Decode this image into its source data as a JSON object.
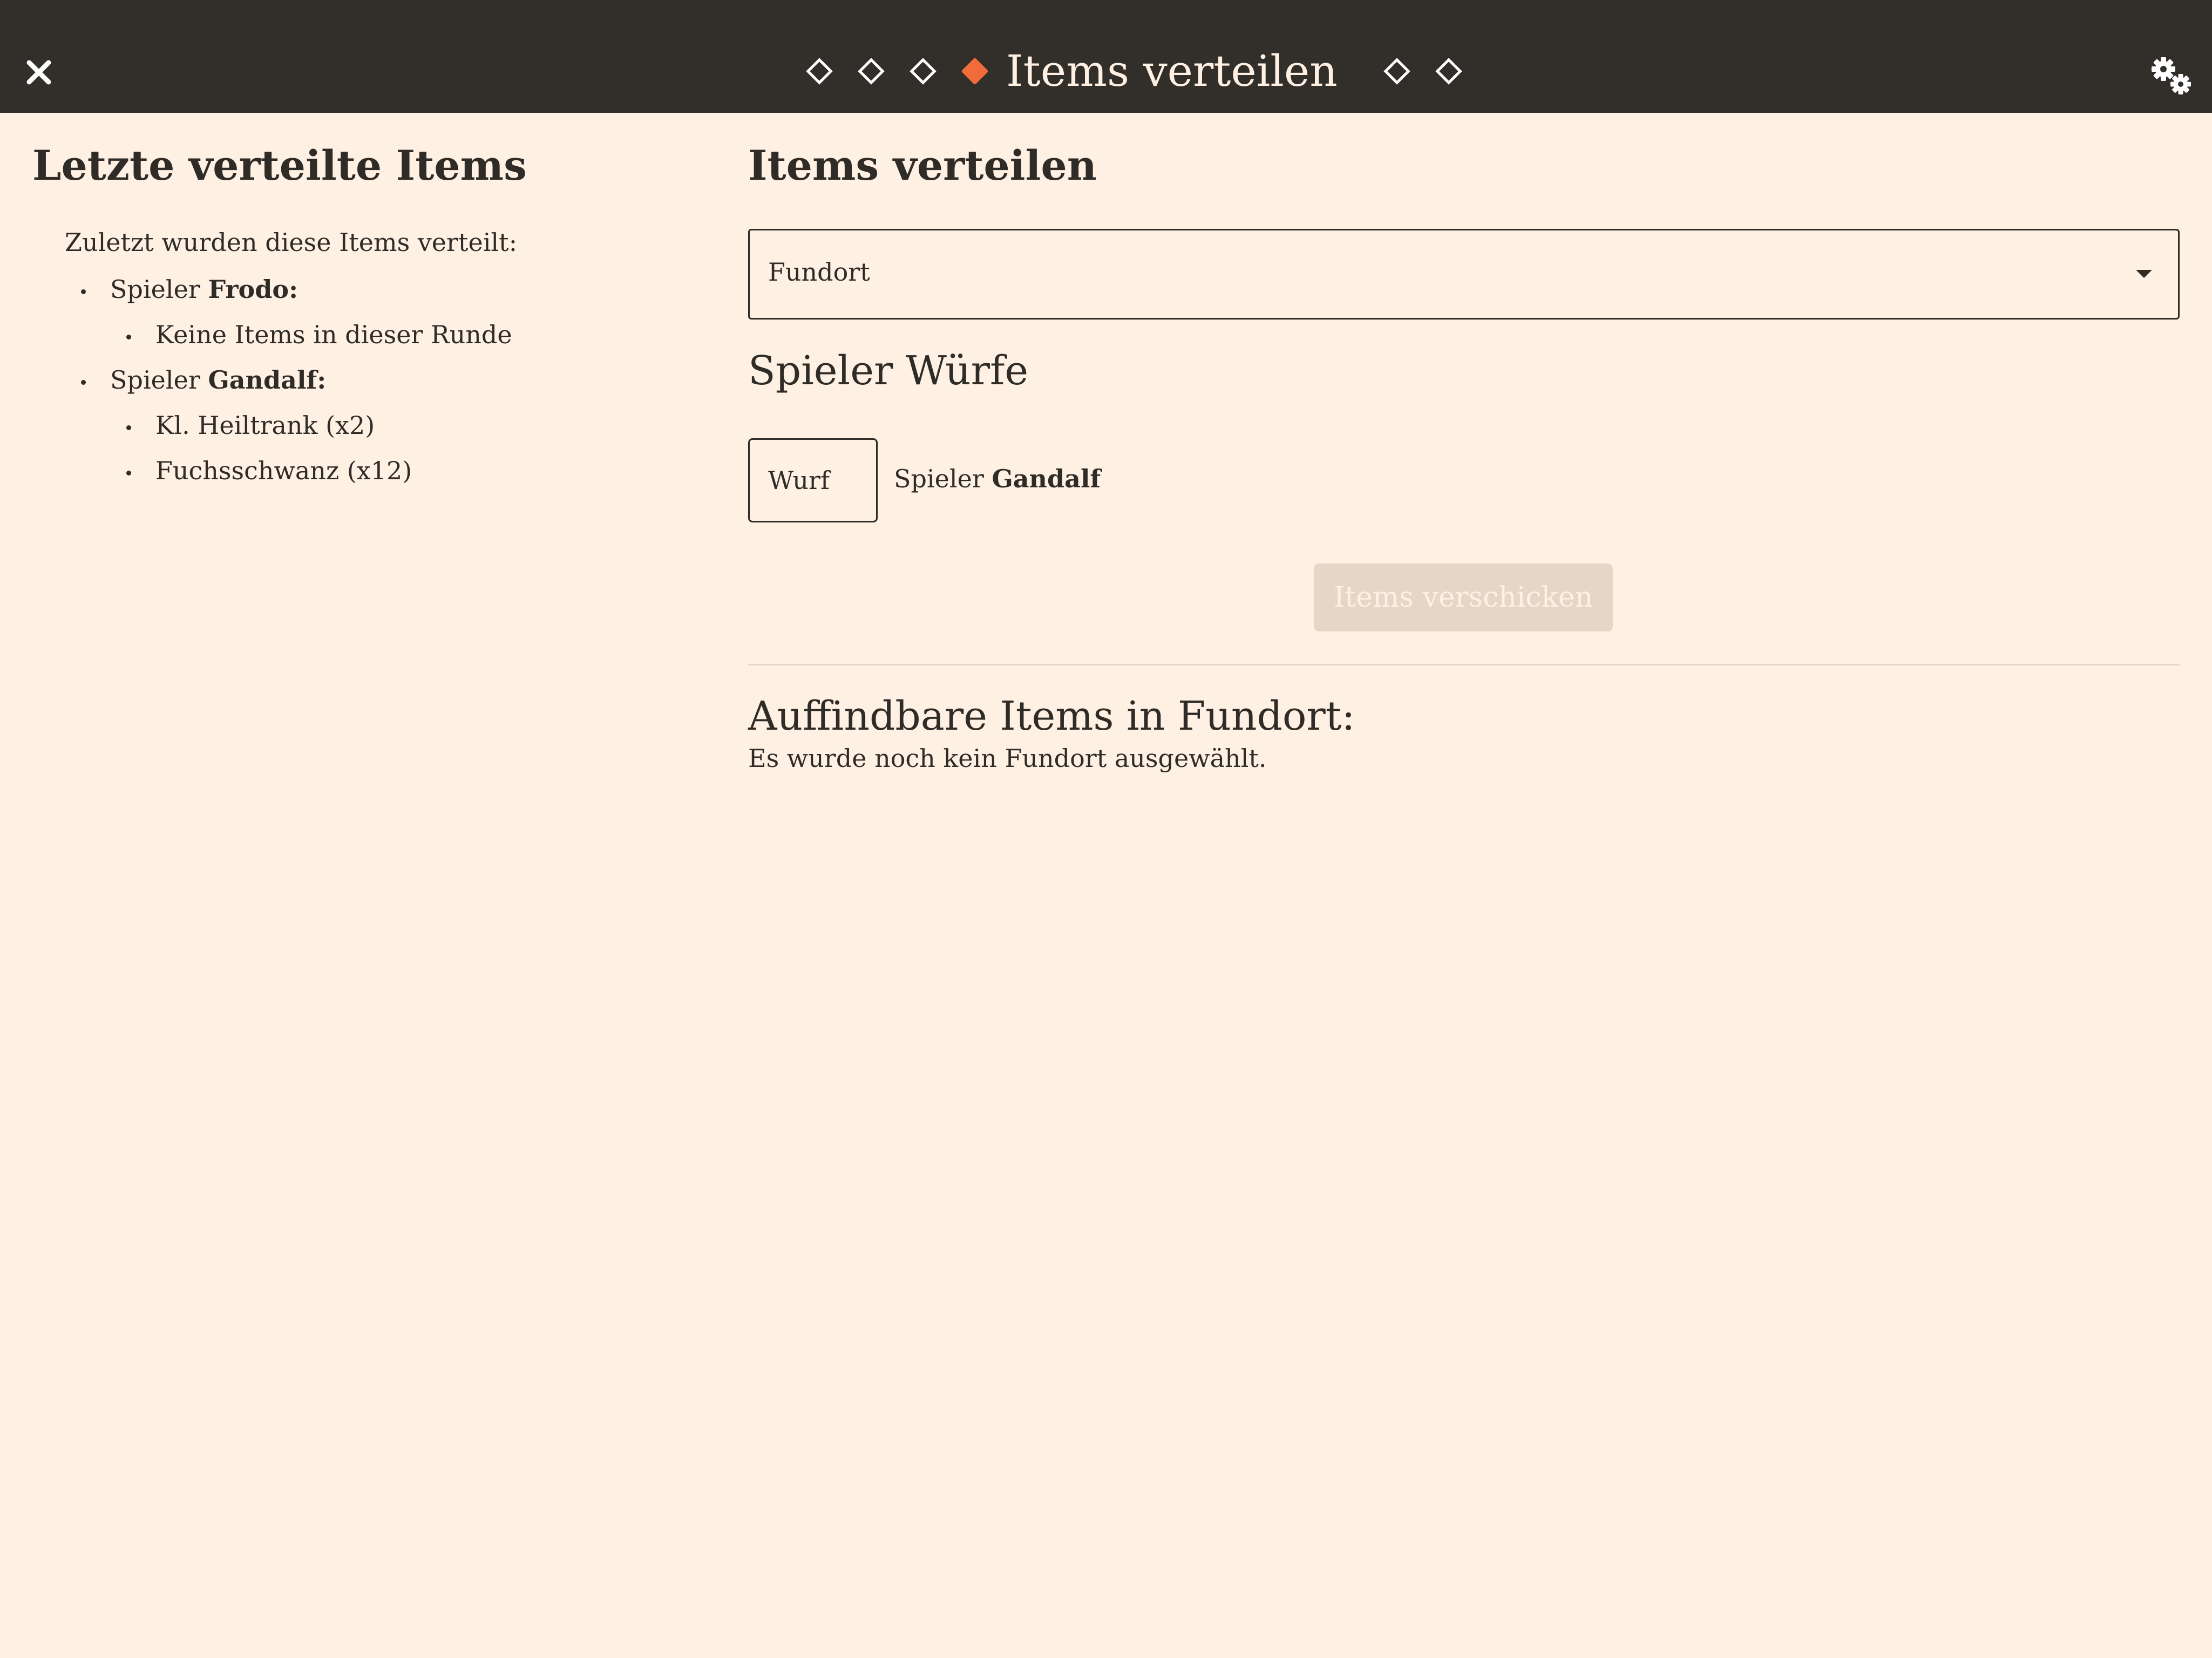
{
  "header": {
    "close_icon": "close-icon",
    "settings_icon": "gears-icon",
    "current_step_title": "Items verteilen",
    "steps_before_current": 3,
    "steps_after_current": 2,
    "active_color": "#f26b3a",
    "bar_color": "#322e2a"
  },
  "recent": {
    "title": "Letzte verteilte Items",
    "intro": "Zuletzt wurden diese Items verteilt:",
    "player_prefix": "Spieler",
    "players": [
      {
        "name": "Frodo:",
        "items": [
          "Keine Items in dieser Runde"
        ]
      },
      {
        "name": "Gandalf:",
        "items": [
          "Kl. Heiltrank (x2)",
          "Fuchsschwanz (x12)"
        ]
      }
    ]
  },
  "distribute": {
    "title": "Items verteilen",
    "location_select": {
      "label": "Fundort",
      "icon": "caret-down-icon"
    },
    "rolls_title": "Spieler Würfe",
    "roll_input_placeholder": "Wurf",
    "roll_player_prefix": "Spieler",
    "roll_player_name": "Gandalf",
    "send_button_label": "Items verschicken",
    "send_button_color": "#e5d6c7"
  },
  "found": {
    "title": "Auffindbare Items in Fundort:",
    "empty_text": "Es wurde noch kein Fundort ausgewählt."
  }
}
